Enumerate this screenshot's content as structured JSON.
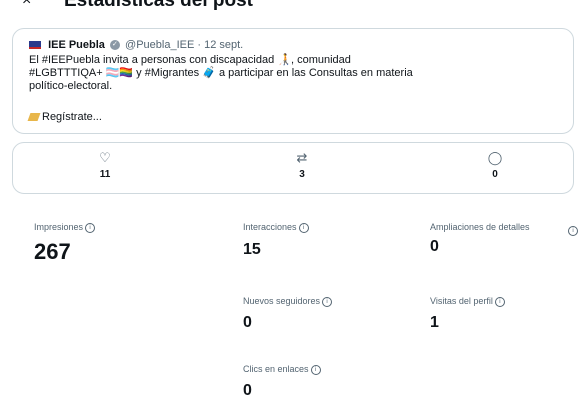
{
  "header": {
    "back_icon": "×",
    "title": "Estadísticas del post"
  },
  "post": {
    "author": "IEE Puebla",
    "handle": "@Puebla_IEE · 12 sept.",
    "text_lines": [
      "El #IEEPuebla invita a personas con discapacidad 🧑‍🦯, comunidad",
      "#LGBTTTIQA+ 🏳️‍⚧️🏳️‍🌈 y #Migrantes 🧳 a participar en las Consultas en materia",
      "político-electoral."
    ],
    "cta": "Regístrate..."
  },
  "engagement": {
    "likes": {
      "icon": "♡",
      "count": "11"
    },
    "reposts": {
      "icon": "⇄",
      "count": "3"
    },
    "replies": {
      "icon": "◯",
      "count": "0"
    }
  },
  "metrics": {
    "impresiones": {
      "label": "Impresiones",
      "value": "267"
    },
    "interacciones": {
      "label": "Interacciones",
      "value": "15"
    },
    "ampliaciones": {
      "label": "Ampliaciones de detalles",
      "value": "0"
    },
    "nuevos_seguidores": {
      "label": "Nuevos seguidores",
      "value": "0"
    },
    "visitas_perfil": {
      "label": "Visitas del perfil",
      "value": "1"
    },
    "clics_enlaces": {
      "label": "Clics en enlaces",
      "value": "0"
    }
  },
  "info_icon": "i"
}
